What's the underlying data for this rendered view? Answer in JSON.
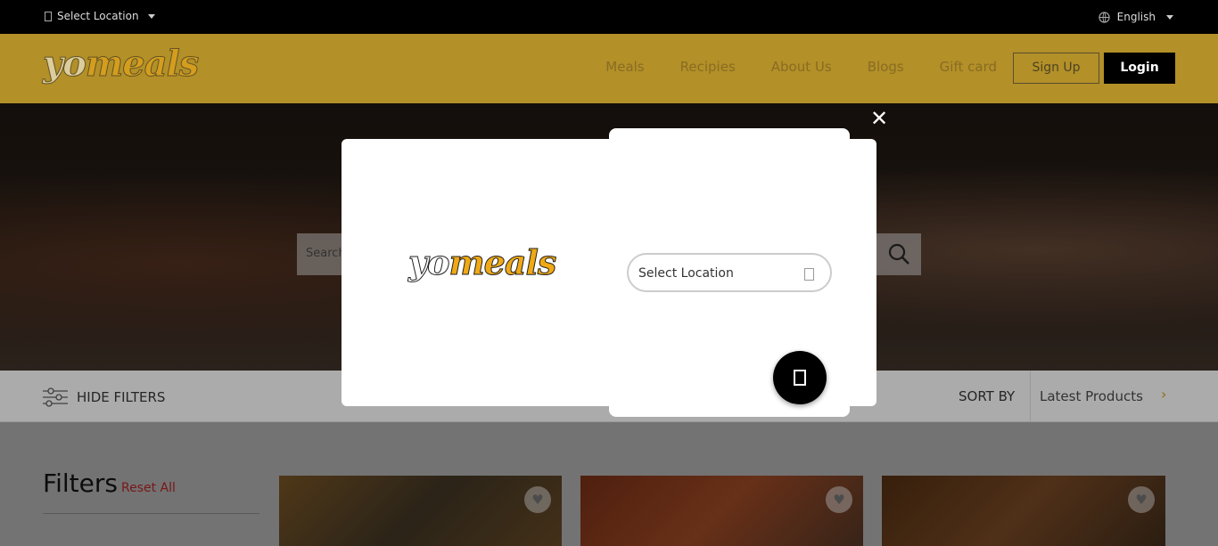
{
  "topbar": {
    "location_label": "Select Location",
    "language_label": "English"
  },
  "header": {
    "logo_yo": "yo",
    "logo_meals": "meals",
    "nav": [
      "Meals",
      "Recipies",
      "About Us",
      "Blogs",
      "Gift card"
    ],
    "signup_label": "Sign Up",
    "login_label": "Login"
  },
  "hero": {
    "search_placeholder": "Search"
  },
  "filterbar": {
    "hide_filters_label": "HIDE FILTERS",
    "sort_by_label": "SORT BY",
    "sort_value": "Latest Products"
  },
  "content": {
    "filters_title": "Filters",
    "reset_label": "Reset All"
  },
  "modal": {
    "logo_yo": "yo",
    "logo_meals": "meals",
    "location_placeholder": "Select Location",
    "close_label": "✕"
  },
  "colors": {
    "header_bg": "#b39028",
    "accent": "#f0a915"
  }
}
